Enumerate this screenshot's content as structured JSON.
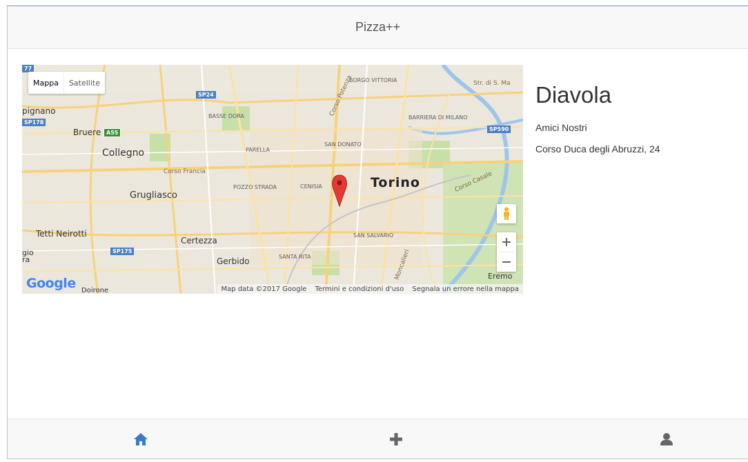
{
  "header": {
    "title": "Pizza++"
  },
  "map": {
    "type_controls": {
      "map_label": "Mappa",
      "satellite_label": "Satellite"
    },
    "labels": {
      "torino": "Torino",
      "collegno": "Collegno",
      "grugliasco": "Grugliasco",
      "bruere": "Bruere",
      "tetti_neirotti": "Tetti Neirotti",
      "certezza": "Certezza",
      "gerbido": "Gerbido",
      "borgo_vittoria": "BORGO VITTORIA",
      "basse_dora": "BASSE DORA",
      "barriera_milano": "BARRIERA DI MILANO",
      "parella": "PARELLA",
      "san_donato": "SAN DONATO",
      "cenisia": "CENISIA",
      "pozzo_strada": "POZZO STRADA",
      "san_salvario": "SAN SALVARIO",
      "santa_rita": "SANTA RITA",
      "corso_francia": "Corso Francia",
      "corso_casale": "Corso Casale",
      "corso_potenza": "Corso Potenza",
      "moncalieri": "Moncalieri",
      "eremo": "Eremo",
      "str_s_ma": "Str. di S. Ma",
      "pignano": "pignano",
      "gio_ra": "gio\nra",
      "doirone": "Doirone"
    },
    "shields": {
      "sp24": "SP24",
      "sp178": "SP178",
      "a55": "A55",
      "sp175": "SP175",
      "sp590": "SP590",
      "n77": "77"
    },
    "google_logo": "Google",
    "attribution": {
      "data": "Map data ©2017 Google",
      "terms": "Termini e condizioni d'uso",
      "report": "Segnala un errore nella mappa"
    },
    "marker_color": "#e53935"
  },
  "detail": {
    "pizza_name": "Diavola",
    "restaurant": "Amici Nostri",
    "address": "Corso Duca degli Abruzzi, 24"
  },
  "footer": {
    "tabs": [
      {
        "icon": "home-icon"
      },
      {
        "icon": "plus-icon"
      },
      {
        "icon": "user-icon"
      }
    ],
    "active_color": "#3a7bc8",
    "inactive_color": "#666666"
  }
}
